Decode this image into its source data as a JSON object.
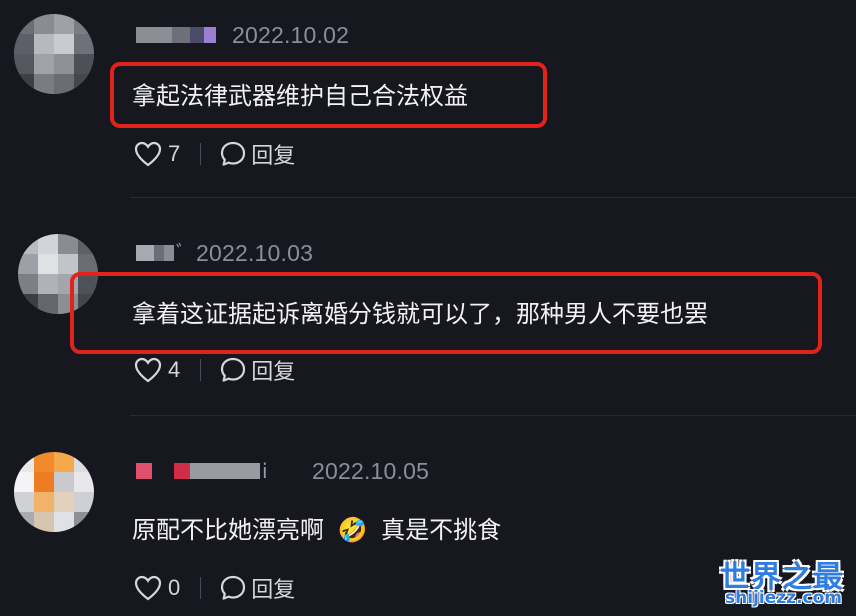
{
  "comments": [
    {
      "date": "2022.10.02",
      "text": "拿起法律武器维护自己合法权益",
      "like_count": "7",
      "reply_label": "回复",
      "highlighted": true,
      "username_tail": ""
    },
    {
      "date": "2022.10.03",
      "text": "拿着这证据起诉离婚分钱就可以了，那种男人不要也罢",
      "like_count": "4",
      "reply_label": "回复",
      "highlighted": true,
      "username_tail": "̄"
    },
    {
      "date": "2022.10.05",
      "text": "原配不比她漂亮啊",
      "emoji": "🤣",
      "text_after": "真是不挑食",
      "like_count": "0",
      "reply_label": "回复",
      "highlighted": false,
      "username_tail": "i"
    }
  ],
  "colors": {
    "background": "#171720",
    "highlight_border": "#e4221c",
    "watermark": "#2f7de1"
  },
  "icons": {
    "like": "heart-outline-icon",
    "reply": "speech-bubble-icon"
  },
  "watermark": {
    "title": "世界之最",
    "subtitle": "shijiezz.com"
  }
}
